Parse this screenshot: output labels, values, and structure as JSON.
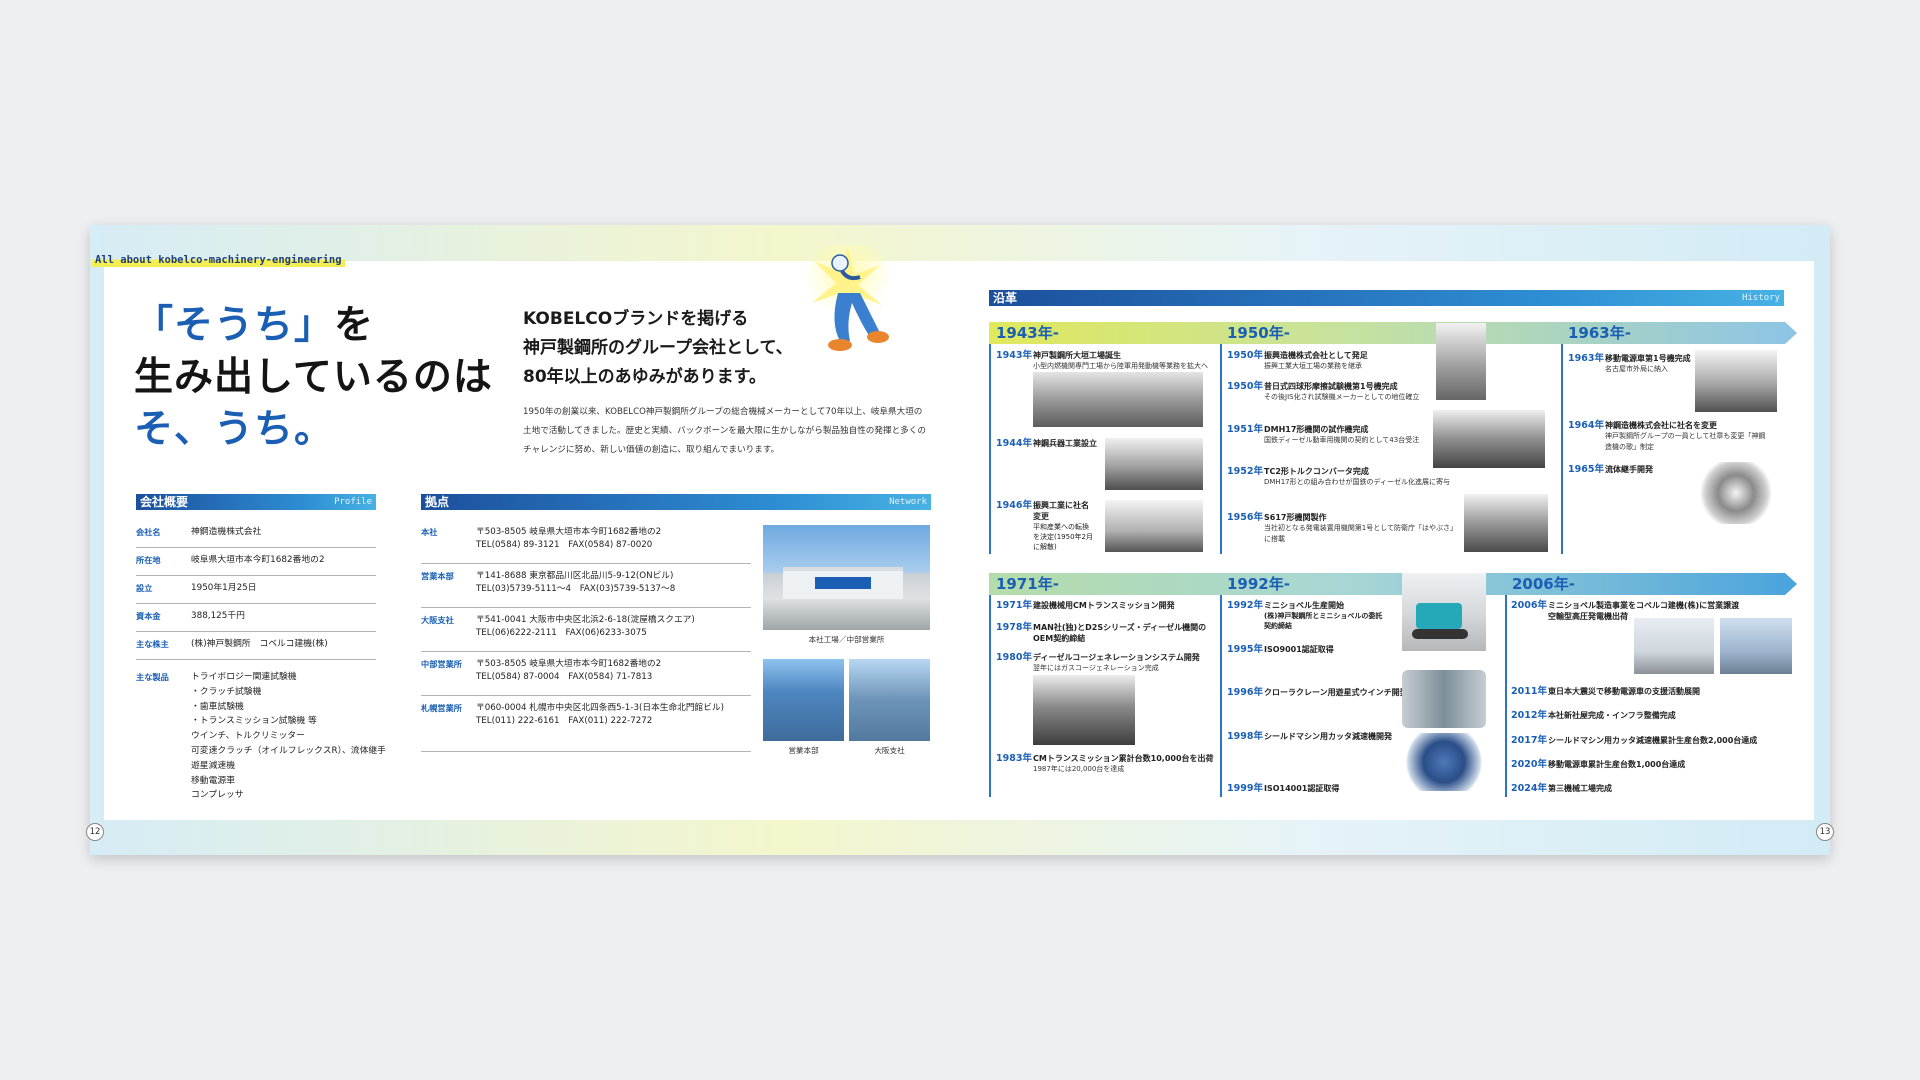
{
  "tag": "All about kobelco-machinery-engineering",
  "page_left": "12",
  "page_right": "13",
  "headline": {
    "l1a": "「そうち」",
    "l1b": "を",
    "l2": "生み出しているのは",
    "l3": "そ、うち。"
  },
  "lead": [
    "KOBELCOブランドを掲げる",
    "神戸製鋼所のグループ会社として、",
    "80年以上のあゆみがあります。"
  ],
  "body": [
    "1950年の創業以来、KOBELCO神戸製鋼所グループの総合機械メーカーとして70年以上、岐阜県大垣の",
    "土地で活動してきました。歴史と実績、バックボーンを最大限に生かしながら製品独自性の発揮と多くの",
    "チャレンジに努め、新しい価値の創造に、取り組んでまいります。"
  ],
  "profile": {
    "title": "会社概要",
    "en": "Profile",
    "rows": [
      {
        "k": "会社名",
        "v": "神鋼造機株式会社"
      },
      {
        "k": "所在地",
        "v": "岐阜県大垣市本今町1682番地の2"
      },
      {
        "k": "設立",
        "v": "1950年1月25日"
      },
      {
        "k": "資本金",
        "v": "388,125千円"
      },
      {
        "k": "主な株主",
        "v": "(株)神戸製鋼所　コベルコ建機(株)"
      }
    ],
    "products_k": "主な製品",
    "products": [
      "トライボロジー関連試験機",
      "・クラッチ試験機",
      "・歯車試験機",
      "・トランスミッション試験機 等",
      "ウインチ、トルクリミッター",
      "可変速クラッチ（オイルフレックスR）、流体継手",
      "遊星減速機",
      "移動電源車",
      "コンプレッサ"
    ]
  },
  "network": {
    "title": "拠点",
    "en": "Network",
    "rows": [
      {
        "k": "本社",
        "v1": "〒503-8505 岐阜県大垣市本今町1682番地の2",
        "v2": "TEL(0584) 89-3121　FAX(0584) 87-0020"
      },
      {
        "k": "営業本部",
        "v1": "〒141-8688 東京都品川区北品川5-9-12(ONビル)",
        "v2": "TEL(03)5739-5111〜4　FAX(03)5739-5137〜8"
      },
      {
        "k": "大阪支社",
        "v1": "〒541-0041 大阪市中央区北浜2-6-18(淀屋橋スクエア)",
        "v2": "TEL(06)6222-2111　FAX(06)6233-3075"
      },
      {
        "k": "中部営業所",
        "v1": "〒503-8505 岐阜県大垣市本今町1682番地の2",
        "v2": "TEL(0584) 87-0004　FAX(0584) 71-7813"
      },
      {
        "k": "札幌営業所",
        "v1": "〒060-0004 札幌市中央区北四条西5-1-3(日本生命北門館ビル)",
        "v2": "TEL(011) 222-6161　FAX(011) 222-7272"
      }
    ],
    "cap1": "本社工場／中部営業所",
    "cap2": "営業本部",
    "cap3": "大阪支社"
  },
  "history": {
    "title": "沿革",
    "en": "History",
    "eras": [
      "1943年-",
      "1950年-",
      "1963年-",
      "1971年-",
      "1992年-",
      "2006年-"
    ],
    "ev1943": [
      {
        "y": "1943年",
        "t": "神戸製鋼所大垣工場誕生",
        "s": "小型内燃機関専門工場から陸軍用発動機等業務を拡大へ"
      },
      {
        "y": "1944年",
        "t": "神鋼兵器工業設立",
        "s": ""
      },
      {
        "y": "1946年",
        "t": "振興工業に社名",
        "s": "変更"
      }
    ],
    "ev1946x": [
      "平和産業への転換",
      "を決定(1950年2月",
      "に解散)"
    ],
    "ev1950": [
      {
        "y": "1950年",
        "t": "振興造機株式会社として発足",
        "s": "振興工業大垣工場の業務を継承"
      },
      {
        "y": "1950年",
        "t": "昔日式四球形摩擦試験機第1号機完成",
        "s": "その後JIS化され試験機メーカーとしての地位確立"
      },
      {
        "y": "1951年",
        "t": "DMH17形機関の試作機完成",
        "s": "国鉄ディーゼル動車用機関の契約として43台受注"
      },
      {
        "y": "1952年",
        "t": "TC2形トルクコンバータ完成",
        "s": "DMH17形との組み合わせが国鉄のディーゼル化進展に寄与"
      },
      {
        "y": "1956年",
        "t": "S617形機関製作",
        "s": "当社初となる発電装置用機関第1号として防衛庁「はやぶさ」"
      }
    ],
    "ev1956x": "に搭載",
    "ev1963": [
      {
        "y": "1963年",
        "t": "移動電源車第1号機完成",
        "s": "名古屋市外局に納入"
      },
      {
        "y": "1964年",
        "t": "神鋼造機株式会社に社名を変更",
        "s": "神戸製鋼所グループの一員として社章も変更「神鋼"
      },
      {
        "y": "1965年",
        "t": "流体継手開発",
        "s": ""
      }
    ],
    "ev1964x": "造機の歌」制定",
    "ev1971": [
      {
        "y": "1971年",
        "t": "建設機械用CMトランスミッション開発",
        "s": ""
      },
      {
        "y": "1978年",
        "t": "MAN社(独)とD2Sシリーズ・ディーゼル機関の",
        "s": ""
      },
      {
        "y": "1980年",
        "t": "ディーゼルコージェネレーションシステム開発",
        "s": "翌年にはガスコージェネレーション完成"
      },
      {
        "y": "1983年",
        "t": "CMトランスミッション累計台数10,000台を出荷",
        "s": "1987年には20,000台を達成"
      }
    ],
    "ev1978x": "OEM契約締結",
    "ev1992": [
      {
        "y": "1992年",
        "t": "ミニショベル生産開始",
        "s": ""
      },
      {
        "y": "1995年",
        "t": "ISO9001認証取得",
        "s": ""
      },
      {
        "y": "1996年",
        "t": "クローラクレーン用遊星式ウインチ開発",
        "s": ""
      },
      {
        "y": "1998年",
        "t": "シールドマシン用カッタ減速機開発",
        "s": ""
      },
      {
        "y": "1999年",
        "t": "ISO14001認証取得",
        "s": ""
      }
    ],
    "ev1992x": [
      "(株)神戸製鋼所とミニショベルの委託",
      "契約締結"
    ],
    "ev2006": [
      {
        "y": "2006年",
        "t": "ミニショベル製造事業をコベルコ建機(株)に営業譲渡",
        "s": ""
      },
      {
        "y": "2011年",
        "t": "東日本大震災で移動電源車の支援活動展開",
        "s": ""
      },
      {
        "y": "2012年",
        "t": "本社新社屋完成・インフラ整備完成",
        "s": ""
      },
      {
        "y": "2017年",
        "t": "シールドマシン用カッタ減速機累計生産台数2,000台達成",
        "s": ""
      },
      {
        "y": "2020年",
        "t": "移動電源車累計生産台数1,000台達成",
        "s": ""
      },
      {
        "y": "2024年",
        "t": "第三機械工場完成",
        "s": ""
      }
    ],
    "ev2006x": "空輸型高圧発電機出荷"
  }
}
